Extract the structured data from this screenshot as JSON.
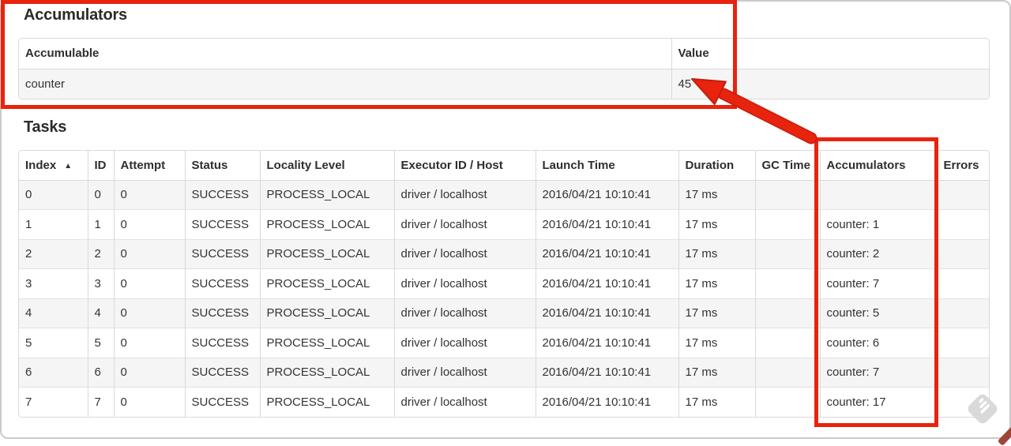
{
  "annotation": {
    "color": "#e8230e"
  },
  "accumulators_section": {
    "heading": "Accumulators",
    "table": {
      "headers": [
        "Accumulable",
        "Value"
      ],
      "rows": [
        [
          "counter",
          "45"
        ]
      ]
    }
  },
  "tasks_section": {
    "heading": "Tasks",
    "sort_ascending_icon": "▲",
    "table": {
      "headers": [
        "Index",
        "ID",
        "Attempt",
        "Status",
        "Locality Level",
        "Executor ID / Host",
        "Launch Time",
        "Duration",
        "GC Time",
        "Accumulators",
        "Errors"
      ],
      "rows": [
        [
          "0",
          "0",
          "0",
          "SUCCESS",
          "PROCESS_LOCAL",
          "driver / localhost",
          "2016/04/21 10:10:41",
          "17 ms",
          "",
          "",
          ""
        ],
        [
          "1",
          "1",
          "0",
          "SUCCESS",
          "PROCESS_LOCAL",
          "driver / localhost",
          "2016/04/21 10:10:41",
          "17 ms",
          "",
          "counter: 1",
          ""
        ],
        [
          "2",
          "2",
          "0",
          "SUCCESS",
          "PROCESS_LOCAL",
          "driver / localhost",
          "2016/04/21 10:10:41",
          "17 ms",
          "",
          "counter: 2",
          ""
        ],
        [
          "3",
          "3",
          "0",
          "SUCCESS",
          "PROCESS_LOCAL",
          "driver / localhost",
          "2016/04/21 10:10:41",
          "17 ms",
          "",
          "counter: 7",
          ""
        ],
        [
          "4",
          "4",
          "0",
          "SUCCESS",
          "PROCESS_LOCAL",
          "driver / localhost",
          "2016/04/21 10:10:41",
          "17 ms",
          "",
          "counter: 5",
          ""
        ],
        [
          "5",
          "5",
          "0",
          "SUCCESS",
          "PROCESS_LOCAL",
          "driver / localhost",
          "2016/04/21 10:10:41",
          "17 ms",
          "",
          "counter: 6",
          ""
        ],
        [
          "6",
          "6",
          "0",
          "SUCCESS",
          "PROCESS_LOCAL",
          "driver / localhost",
          "2016/04/21 10:10:41",
          "17 ms",
          "",
          "counter: 7",
          ""
        ],
        [
          "7",
          "7",
          "0",
          "SUCCESS",
          "PROCESS_LOCAL",
          "driver / localhost",
          "2016/04/21 10:10:41",
          "17 ms",
          "",
          "counter: 17",
          ""
        ]
      ]
    }
  },
  "watermark_icon": "feedly-logo"
}
